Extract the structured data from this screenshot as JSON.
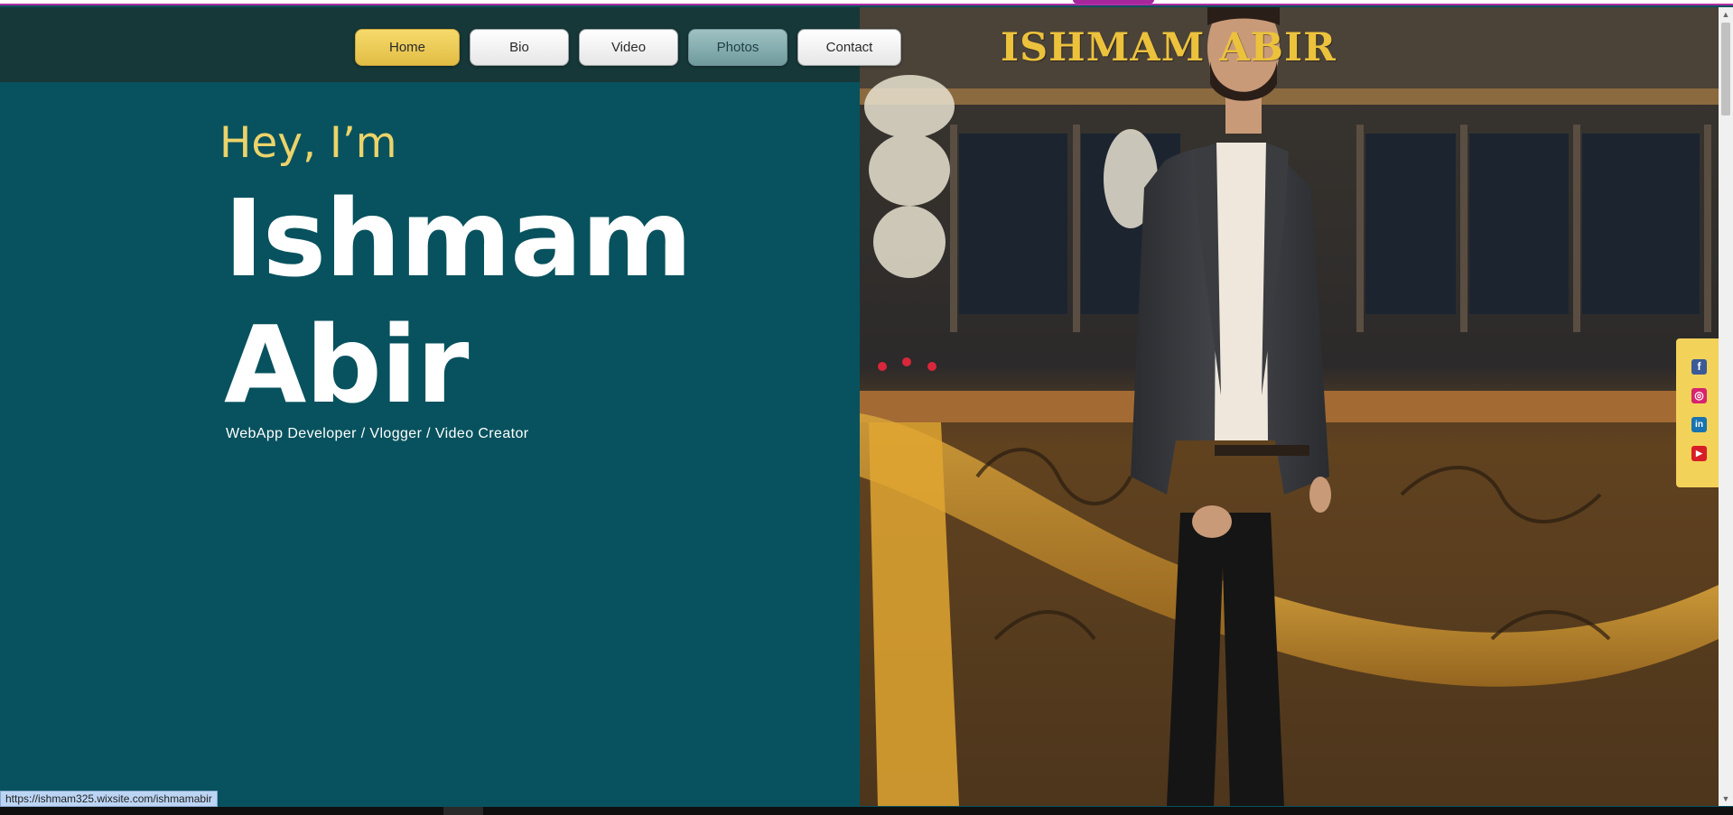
{
  "nav": {
    "buttons": [
      {
        "label": "Home"
      },
      {
        "label": "Bio"
      },
      {
        "label": "Video"
      },
      {
        "label": "Photos"
      },
      {
        "label": "Contact"
      }
    ]
  },
  "brand": {
    "title": "ISHMAM ABIR"
  },
  "hero": {
    "greeting": "Hey, I’m",
    "first_name": "Ishmam",
    "last_name": "Abir",
    "tagline": "WebApp Developer / Vlogger / Video Creator"
  },
  "social": {
    "icons": [
      "facebook-icon",
      "instagram-icon",
      "linkedin-icon",
      "youtube-icon"
    ]
  },
  "status_bar": {
    "url": "https://ishmam325.wixsite.com/ishmamabir"
  },
  "colors": {
    "left_panel": "#07525e",
    "nav_bar": "#163838",
    "accent_yellow": "#ecd36a",
    "brand_gold": "#ecc23c",
    "top_rule": "#b02da3"
  }
}
